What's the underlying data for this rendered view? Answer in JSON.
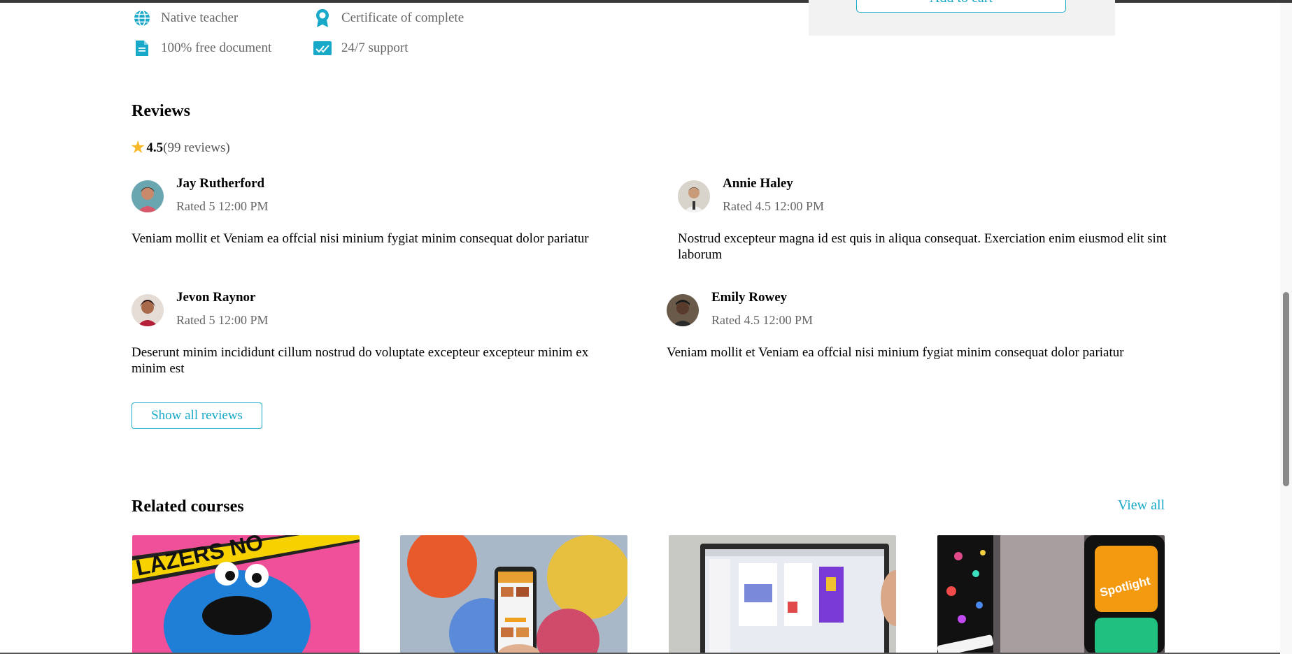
{
  "features": {
    "native_teacher": "Native teacher",
    "certificate": "Certificate of complete",
    "free_document": "100% free document",
    "support": "24/7 support"
  },
  "cart": {
    "add_to_cart_label": "Add to cart"
  },
  "reviews": {
    "title": "Reviews",
    "rating_value": "4.5",
    "rating_count": "(99 reviews)",
    "items": [
      {
        "name": "Jay Rutherford",
        "meta": "Rated 5 12:00 PM",
        "text": "Veniam mollit et Veniam ea offcial nisi minium fygiat minim consequat dolor pariatur"
      },
      {
        "name": "Annie Haley",
        "meta": "Rated 4.5 12:00 PM",
        "text": "Nostrud excepteur magna id est quis in aliqua consequat. Exerciation enim eiusmod elit sint laborum"
      },
      {
        "name": "Jevon Raynor",
        "meta": "Rated 5 12:00 PM",
        "text": "Deserunt minim incididunt cillum nostrud do voluptate excepteur excepteur minim ex minim est"
      },
      {
        "name": "Emily Rowey",
        "meta": "Rated 4.5 12:00 PM",
        "text": "Veniam mollit et Veniam ea offcial nisi minium fygiat minim consequat dolor pariatur"
      }
    ],
    "show_all_label": "Show all reviews"
  },
  "related": {
    "title": "Related courses",
    "view_all_label": "View all"
  },
  "colors": {
    "accent": "#18a9c8",
    "star": "#f7b928",
    "muted_text": "#666666"
  },
  "icons": [
    "globe-icon",
    "ribbon-icon",
    "document-icon",
    "check-chart-icon",
    "star-icon"
  ]
}
